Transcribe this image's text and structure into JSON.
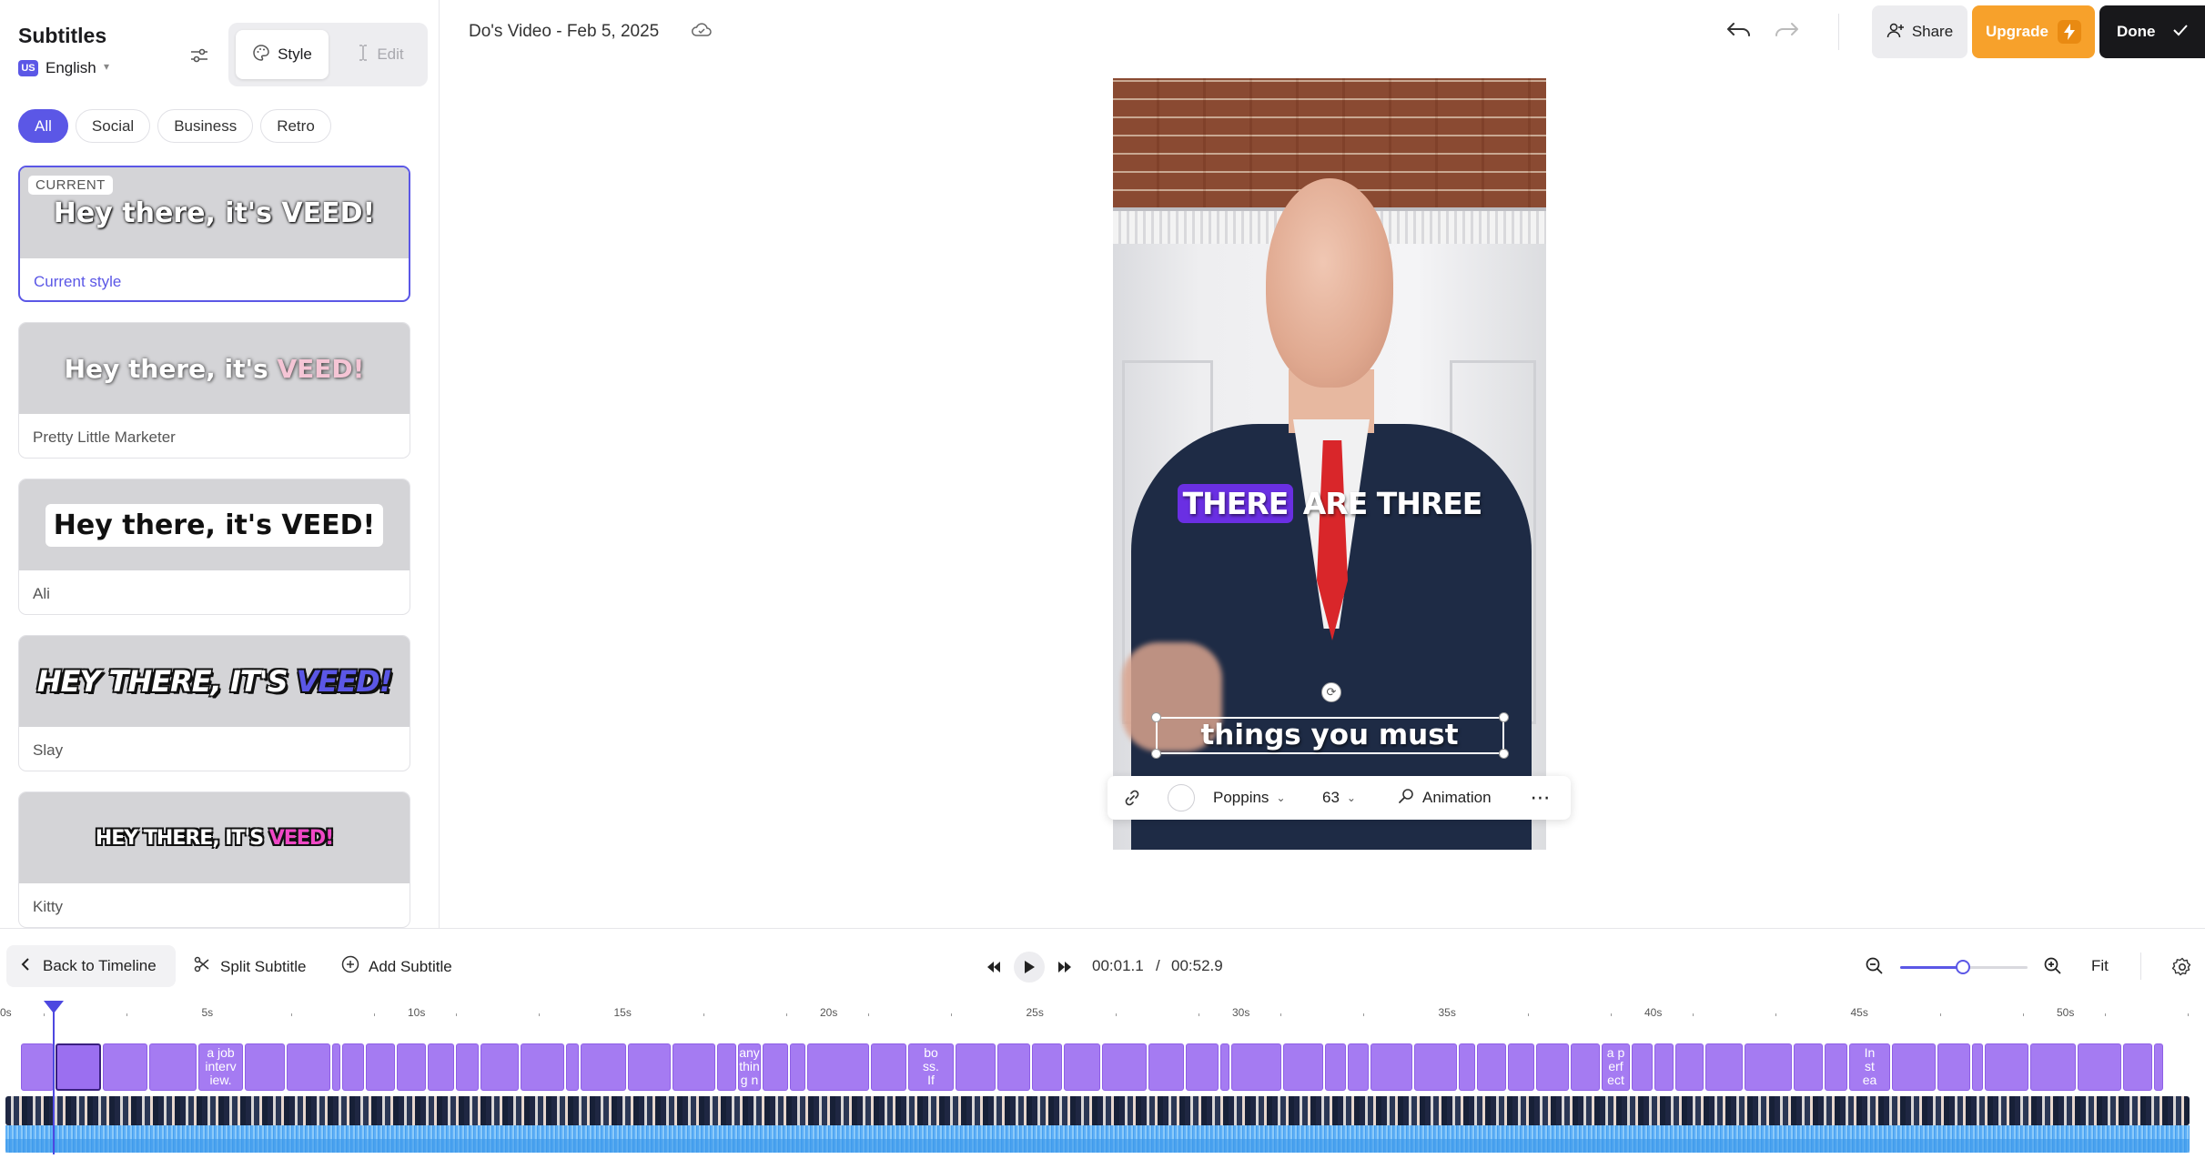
{
  "sidebar": {
    "title": "Subtitles",
    "language": {
      "code": "US",
      "label": "English"
    },
    "tabs": [
      {
        "label": "Style"
      },
      {
        "label": "Edit"
      }
    ],
    "filters": [
      "All",
      "Social",
      "Business",
      "Retro"
    ],
    "active_filter": "All",
    "cards": [
      {
        "badge": "CURRENT",
        "preview_text": "Hey there, it's VEED!",
        "name": "Current style"
      },
      {
        "preview_text": "Hey there, it's ",
        "preview_highlight": "VEED!",
        "name": "Pretty Little Marketer"
      },
      {
        "preview_text": "Hey there, it's VEED!",
        "name": "Ali"
      },
      {
        "preview_text": "HEY THERE, IT'S ",
        "preview_highlight": "VEED!",
        "name": "Slay"
      },
      {
        "preview_text": "HEY THERE, IT'S ",
        "preview_highlight": "VEED!",
        "name": "Kitty"
      }
    ]
  },
  "header": {
    "project_title": "Do's Video - Feb 5, 2025",
    "share_label": "Share",
    "upgrade_label": "Upgrade",
    "done_label": "Done"
  },
  "canvas": {
    "caption_line1_highlight": "THERE",
    "caption_line1_rest": " ARE THREE",
    "caption_line2": "things you must"
  },
  "text_toolbar": {
    "font": "Poppins",
    "size": "63",
    "animation_label": "Animation"
  },
  "bottom_bar": {
    "back_label": "Back to Timeline",
    "split_label": "Split Subtitle",
    "add_label": "Add Subtitle",
    "current_time": "00:01.1",
    "separator": "/",
    "total_time": "00:52.9",
    "fit_label": "Fit",
    "zoom_level": 0.49
  },
  "timeline": {
    "ruler_labels": [
      "0s",
      "5s",
      "10s",
      "15s",
      "20s",
      "25s",
      "30s",
      "35s",
      "40s",
      "45s",
      "50s"
    ],
    "segment_texts": [
      {
        "text": "a job\ninterv\niew."
      },
      {
        "text": "any\nthin\ng n"
      },
      {
        "text": "bo\nss.\nIf"
      },
      {
        "text": "a p\nerf\nect"
      },
      {
        "text": "In\nst\nea"
      }
    ],
    "playhead_time": "00:01.1"
  },
  "colors": {
    "accent": "#5b57e6",
    "upgrade": "#f7a12b",
    "done": "#18181b",
    "subtitle_block": "#a57bf2",
    "caption_highlight": "#6a2fe3"
  }
}
